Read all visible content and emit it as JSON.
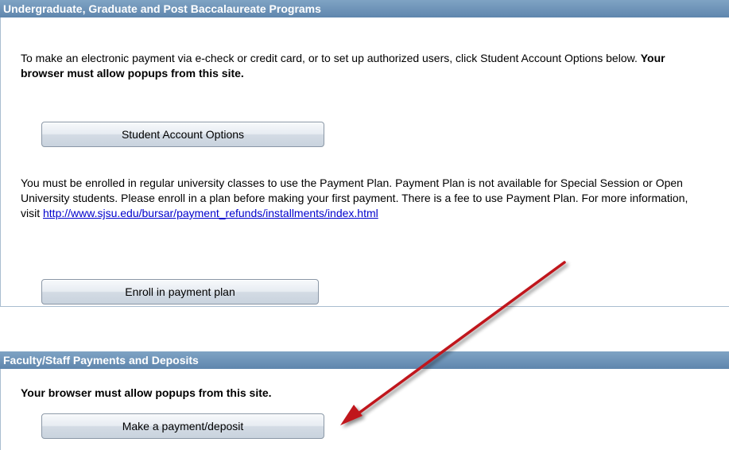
{
  "section1": {
    "title": "Undergraduate, Graduate and Post Baccalaureate Programs",
    "intro_text": "To make an electronic payment via e-check or credit card, or to set up authorized users, click Student Account Options below. ",
    "popup_warning": "Your browser must allow popups from this site.",
    "student_account_button": "Student Account Options",
    "payment_plan_text": "You must be enrolled in regular university classes to use the Payment Plan. Payment Plan is not available for Special Session or Open University students. Please enroll in a plan before making your first payment. There is a fee to use Payment Plan. For more information, visit ",
    "payment_plan_link": "http://www.sjsu.edu/bursar/payment_refunds/installments/index.html",
    "enroll_button": "Enroll in payment plan"
  },
  "section2": {
    "title": "Faculty/Staff Payments and Deposits",
    "popup_warning": "Your browser must allow popups from this site.",
    "payment_button": "Make a payment/deposit"
  },
  "annotation": {
    "arrow_color": "#c0181e"
  },
  "colors": {
    "header_bg": "#6b90b5",
    "header_text": "#ffffff",
    "link": "#0000cc"
  }
}
